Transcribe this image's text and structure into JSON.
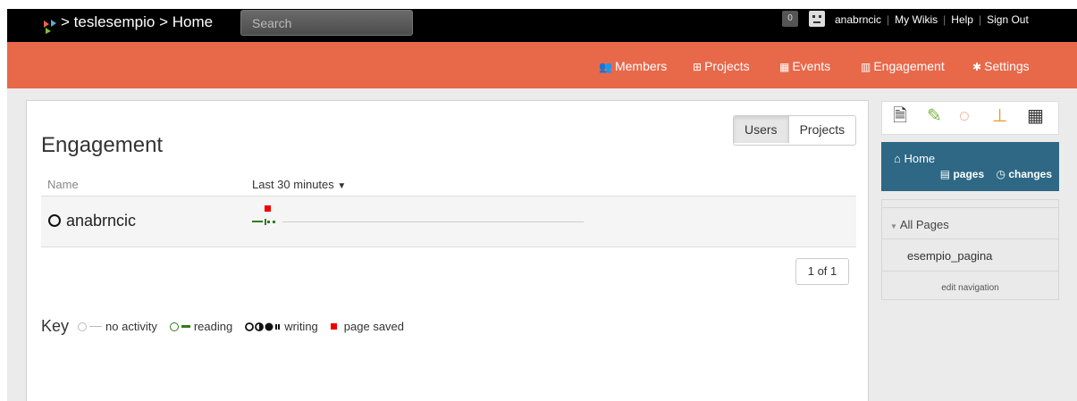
{
  "header": {
    "breadcrumb": "> teslesempio > Home",
    "search_placeholder": "Search",
    "notification_count": "0",
    "username": "anabrncic",
    "my_wikis": "My Wikis",
    "help": "Help",
    "sign_out": "Sign Out",
    "separator": "|"
  },
  "nav": {
    "members": "Members",
    "projects": "Projects",
    "events": "Events",
    "engagement": "Engagement",
    "settings": "Settings"
  },
  "main": {
    "title": "Engagement",
    "toggle": {
      "users": "Users",
      "projects": "Projects"
    },
    "col_name": "Name",
    "col_range": "Last 30 minutes",
    "rows": [
      {
        "user": "anabrncic"
      }
    ],
    "pager": "1 of 1",
    "key": {
      "label": "Key",
      "no_activity": "no activity",
      "reading": "reading",
      "writing": "writing",
      "page_saved": "page saved"
    }
  },
  "sidebar": {
    "icons": [
      "page-icon",
      "paperclip-icon",
      "comment-icon",
      "sitemap-icon",
      "calendar-icon"
    ],
    "home": "Home",
    "pages_link": "pages",
    "changes_link": "changes",
    "all_pages": "All Pages",
    "page_item": "esempio_pagina",
    "edit_navigation": "edit navigation"
  },
  "colors": {
    "topbar": "#000000",
    "accent": "#e8684a",
    "sidebar_home": "#2e6885",
    "reading": "#2e7d18",
    "saved": "#ee0000"
  }
}
